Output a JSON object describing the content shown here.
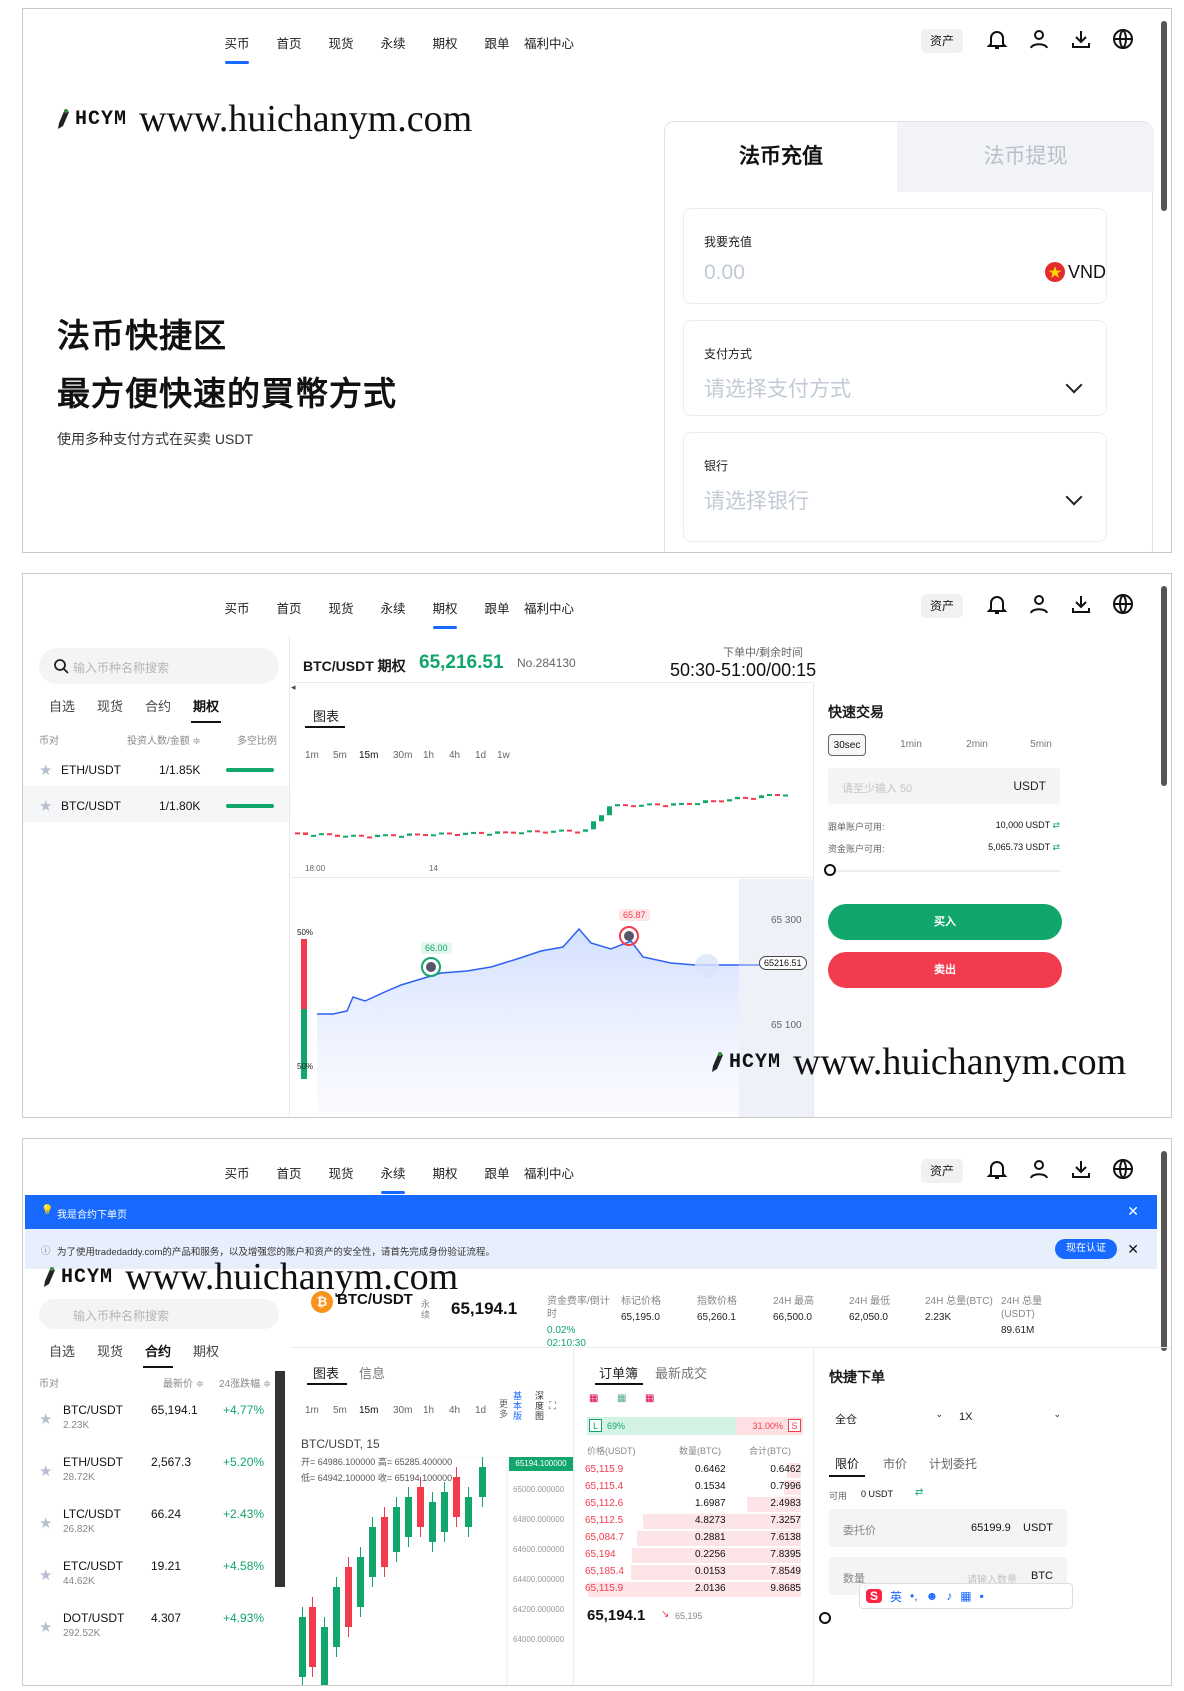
{
  "nav": {
    "links": [
      "买币",
      "首页",
      "现货",
      "永续",
      "期权",
      "跟单",
      "福利中心"
    ],
    "asset_label": "资产",
    "icons": [
      "bell-icon",
      "user-icon",
      "download-icon",
      "globe-icon"
    ]
  },
  "watermark": {
    "logo": "HCYM",
    "url": "www.huichanym.com"
  },
  "s1": {
    "hero_title": "法币快捷区",
    "hero_subtitle": "最方便快速的買幣方式",
    "hero_desc": "使用多种支付方式在买卖 USDT",
    "tab_deposit": "法币充值",
    "tab_withdraw": "法币提现",
    "amount_label": "我要充值",
    "amount_value": "0.00",
    "currency": "VND",
    "payment_label": "支付方式",
    "payment_placeholder": "请选择支付方式",
    "bank_label": "银行",
    "bank_placeholder": "请选择银行"
  },
  "s2": {
    "search_placeholder": "输入币种名称搜索",
    "market_tabs": [
      "自选",
      "现货",
      "合约",
      "期权"
    ],
    "col_pair": "币对",
    "col_investors": "投资人数/金额 ≑",
    "col_ratio": "多空比例",
    "pairs": [
      {
        "name": "ETH/USDT",
        "value": "1/1.85K"
      },
      {
        "name": "BTC/USDT",
        "value": "1/1.80K"
      }
    ],
    "title": "BTC/USDT 期权",
    "price": "65,216.51",
    "order_no": "No.284130",
    "countdown_label": "下单中/剩余时间",
    "countdown_value": "50:30-51:00/00:15",
    "chart_tab": "图表",
    "intervals": [
      "1m",
      "5m",
      "15m",
      "30m",
      "1h",
      "4h",
      "1d",
      "1w"
    ],
    "x_ticks": [
      "18:00",
      "14"
    ],
    "marker_up": "66.00",
    "marker_down": "65.87",
    "y_top": "65 300",
    "y_mid": "65216.51",
    "y_bottom": "65 100",
    "pct_top": "50%",
    "pct_bottom": "50%",
    "quick_title": "快速交易",
    "periods": [
      "30sec",
      "1min",
      "2min",
      "5min"
    ],
    "amount_placeholder": "请至少输入 50",
    "amount_unit": "USDT",
    "copy_avail_label": "跟单账户可用:",
    "copy_avail_value": "10,000 USDT",
    "fund_avail_label": "资金账户可用:",
    "fund_avail_value": "5,065.73 USDT",
    "buy_label": "买入",
    "sell_label": "卖出"
  },
  "s3": {
    "banner_text": "我是合约下单页",
    "notice_text": "为了使用tradedaddy.com的产品和服务，以及增强您的账户和资产的安全性，请首先完成身份验证流程。",
    "verify_btn": "现在认证",
    "search_placeholder": "输入币种名称搜索",
    "market_tabs": [
      "自选",
      "现货",
      "合约",
      "期权"
    ],
    "col_pair": "币对",
    "col_price": "最新价 ≑",
    "col_change": "24涨跌幅 ≑",
    "rows": [
      {
        "name": "BTC/USDT",
        "vol": "2.23K",
        "price": "65,194.1",
        "change": "+4.77%"
      },
      {
        "name": "ETH/USDT",
        "vol": "28.72K",
        "price": "2,567.3",
        "change": "+5.20%"
      },
      {
        "name": "LTC/USDT",
        "vol": "26.82K",
        "price": "66.24",
        "change": "+2.43%"
      },
      {
        "name": "ETC/USDT",
        "vol": "44.62K",
        "price": "19.21",
        "change": "+4.58%"
      },
      {
        "name": "DOT/USDT",
        "vol": "292.52K",
        "price": "4.307",
        "change": "+4.93%"
      }
    ],
    "pair": "BTC/USDT",
    "perp_tag": "永续",
    "price": "65,194.1",
    "stats": [
      {
        "label": "资金费率/倒计时",
        "value": "0.02% 02:10:30"
      },
      {
        "label": "标记价格",
        "value": "65,195.0"
      },
      {
        "label": "指数价格",
        "value": "65,260.1"
      },
      {
        "label": "24H 最高",
        "value": "66,500.0"
      },
      {
        "label": "24H 最低",
        "value": "62,050.0"
      },
      {
        "label": "24H 总量(BTC)",
        "value": "2.23K"
      },
      {
        "label": "24H 总量 (USDT)",
        "value": "89.61M"
      }
    ],
    "chart_tabs": [
      "图表",
      "信息"
    ],
    "intervals": [
      "1m",
      "5m",
      "15m",
      "30m",
      "1h",
      "4h",
      "1d"
    ],
    "more": "更多",
    "basic": "基本版",
    "depth": "深度图",
    "ohlc_title": "BTC/USDT, 15",
    "ohlc_line1": "开= 64986.100000  高= 65285.400000",
    "ohlc_line2": "低= 64942.100000  收= 65194.100000",
    "price_tag": "65194.100000",
    "y_ticks": [
      "65000.000000",
      "64800.000000",
      "64600.000000",
      "64400.000000",
      "64200.000000",
      "64000.000000"
    ],
    "book_tabs": [
      "订单簿",
      "最新成交"
    ],
    "long_pct": "69%",
    "short_pct": "31.00%",
    "book_cols": [
      "价格(USDT)",
      "数量(BTC)",
      "合计(BTC)"
    ],
    "asks": [
      [
        "65,115.9",
        "0.6462",
        "0.6462"
      ],
      [
        "65,115.4",
        "0.1534",
        "0.7996"
      ],
      [
        "65,112.6",
        "1.6987",
        "2.4983"
      ],
      [
        "65,112.5",
        "4.8273",
        "7.3257"
      ],
      [
        "65,084.7",
        "0.2881",
        "7.6138"
      ],
      [
        "65,194",
        "0.2256",
        "7.8395"
      ],
      [
        "65,185.4",
        "0.0153",
        "7.8549"
      ],
      [
        "65,115.9",
        "2.0136",
        "9.8685"
      ]
    ],
    "last_price": "65,194.1",
    "last_mark": "65,195",
    "order_title": "快捷下单",
    "margin_mode": "全仓",
    "leverage": "1X",
    "order_types": [
      "限价",
      "市价",
      "计划委托"
    ],
    "avail_label": "可用",
    "avail_value": "0 USDT",
    "entrust_label": "委托价",
    "entrust_value": "65199.9",
    "entrust_unit": "USDT",
    "qty_label": "数量",
    "qty_placeholder": "请输入数量",
    "qty_unit": "BTC",
    "ime_label": "英"
  },
  "colors": {
    "accent": "#1769ff",
    "green": "#11a66b",
    "red": "#f23b4d"
  }
}
